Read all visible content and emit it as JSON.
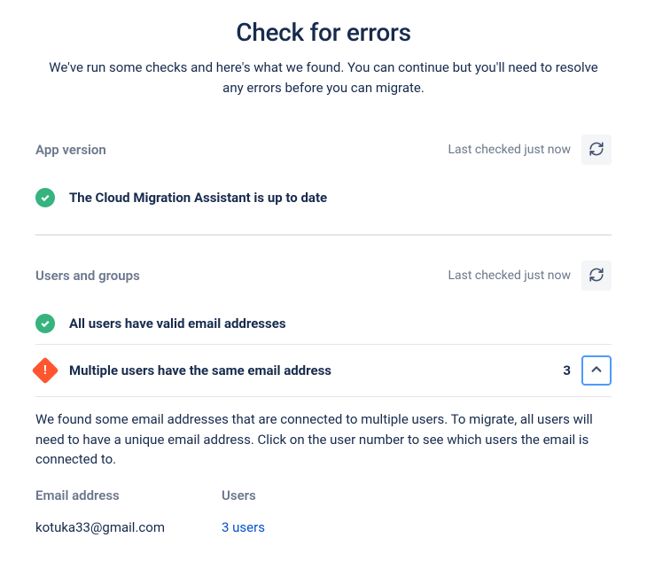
{
  "header": {
    "title": "Check for errors",
    "subtitle": "We've run some checks and here's what we found. You can continue but you'll need to resolve any errors before you can migrate."
  },
  "sections": {
    "app_version": {
      "title": "App version",
      "last_checked": "Last checked just now",
      "check_label": "The Cloud Migration Assistant is up to date"
    },
    "users_groups": {
      "title": "Users and groups",
      "last_checked": "Last checked just now",
      "check_valid_label": "All users have valid email addresses",
      "check_duplicate_label": "Multiple users have the same email address",
      "duplicate_count": "3",
      "detail_text": "We found some email addresses that are connected to multiple users. To migrate, all users will need to have a unique email address. Click on the user number to see which users the email is connected to.",
      "col_email_header": "Email address",
      "col_users_header": "Users",
      "rows": {
        "0": {
          "email": "kotuka33@gmail.com",
          "users": "3 users"
        }
      }
    }
  }
}
